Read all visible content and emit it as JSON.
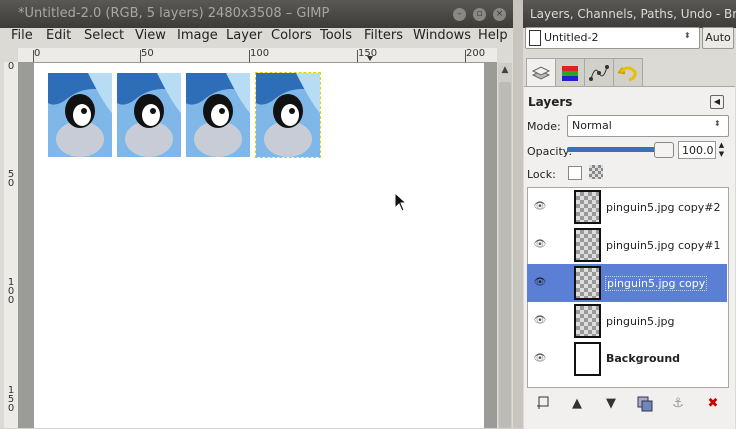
{
  "left_window": {
    "title": "*Untitled-2.0 (RGB, 5 layers) 2480x3508 – GIMP",
    "menu": [
      "File",
      "Edit",
      "Select",
      "View",
      "Image",
      "Layer",
      "Colors",
      "Tools",
      "Filters",
      "Windows",
      "Help"
    ],
    "ruler_h_labels": [
      "0",
      "50",
      "100",
      "150",
      "200"
    ],
    "ruler_v_labels": [
      "0",
      "50",
      "100",
      "150"
    ],
    "canvas_penguin_count": 4
  },
  "dock": {
    "title": "Layers, Channels, Paths, Undo - Brus",
    "image_select": "Untitled-2",
    "auto_button": "Auto",
    "tabs": [
      "layers-icon",
      "channels-icon",
      "paths-icon",
      "undo-icon"
    ],
    "layers": {
      "heading": "Layers",
      "mode_label": "Mode:",
      "mode_value": "Normal",
      "opacity_label": "Opacity:",
      "opacity_value": "100.0",
      "lock_label": "Lock:",
      "list": [
        {
          "name": "pinguin5.jpg copy#2",
          "visible": true,
          "selected": false
        },
        {
          "name": "pinguin5.jpg copy#1",
          "visible": true,
          "selected": false
        },
        {
          "name": "pinguin5.jpg copy",
          "visible": true,
          "selected": true
        },
        {
          "name": "pinguin5.jpg",
          "visible": true,
          "selected": false
        },
        {
          "name": "Background",
          "visible": true,
          "selected": false
        }
      ]
    }
  },
  "colors": {
    "selection": "#5b7fd4",
    "delete": "#cc0000",
    "titlebar": "#3c3b37"
  }
}
